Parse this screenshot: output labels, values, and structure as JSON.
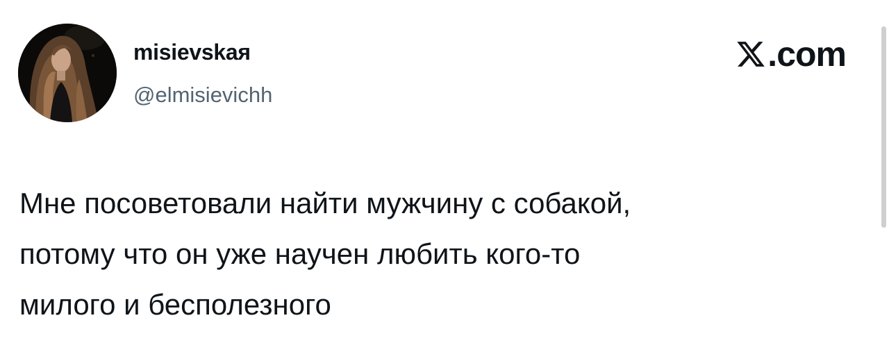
{
  "author": {
    "display_name": "misievskaя",
    "handle": "@elmisievichh"
  },
  "brand": {
    "text": ".com",
    "icon": "x-logo-icon"
  },
  "tweet": {
    "lines": [
      "Мне посоветовали найти мужчину с собакой,",
      "потому что он уже научен любить кого-то",
      "милого и бесполезного"
    ]
  },
  "colors": {
    "text_primary": "#0f1419",
    "text_secondary": "#536471",
    "background": "#ffffff"
  }
}
